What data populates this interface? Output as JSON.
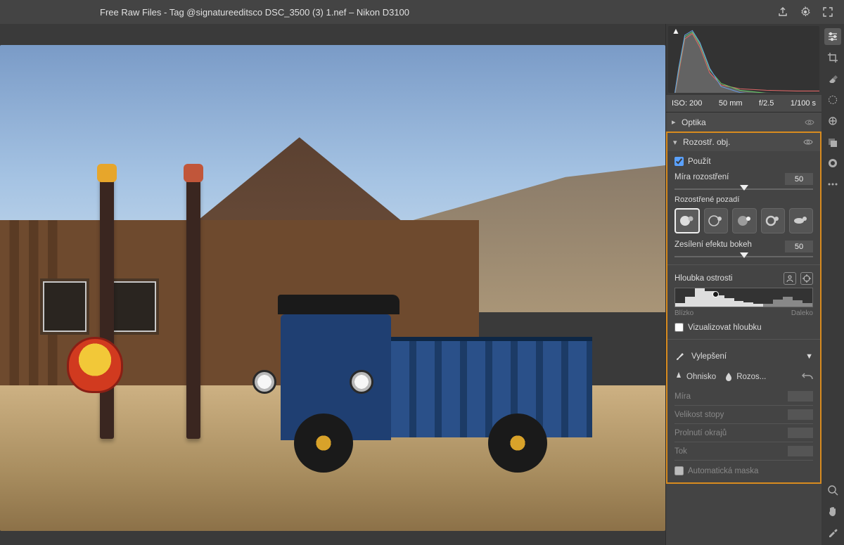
{
  "titlebar": {
    "title": "Free Raw Files - Tag @signatureeditsco DSC_3500 (3) 1.nef  –  Nikon D3100"
  },
  "exif": {
    "iso": "ISO: 200",
    "focal": "50 mm",
    "aperture": "f/2.5",
    "shutter": "1/100 s"
  },
  "sections": {
    "optika": {
      "label": "Optika"
    },
    "rozostr": {
      "label": "Rozostř. obj.",
      "use_label": "Použít",
      "amount_label": "Míra rozostření",
      "amount_value": "50",
      "bg_label": "Rozostřené pozadí",
      "bokeh_gain_label": "Zesílení efektu bokeh",
      "bokeh_gain_value": "50",
      "depth_label": "Hloubka ostrosti",
      "near": "Blízko",
      "far": "Daleko",
      "visualize_label": "Vizualizovat hloubku"
    },
    "vylepseni": {
      "label": "Vylepšení",
      "tab_focus": "Ohnisko",
      "tab_blur": "Rozos...",
      "param_mira": "Míra",
      "param_stopy": "Velikost stopy",
      "param_okraju": "Prolnutí okrajů",
      "param_tok": "Tok",
      "automask": "Automatická maska"
    }
  }
}
